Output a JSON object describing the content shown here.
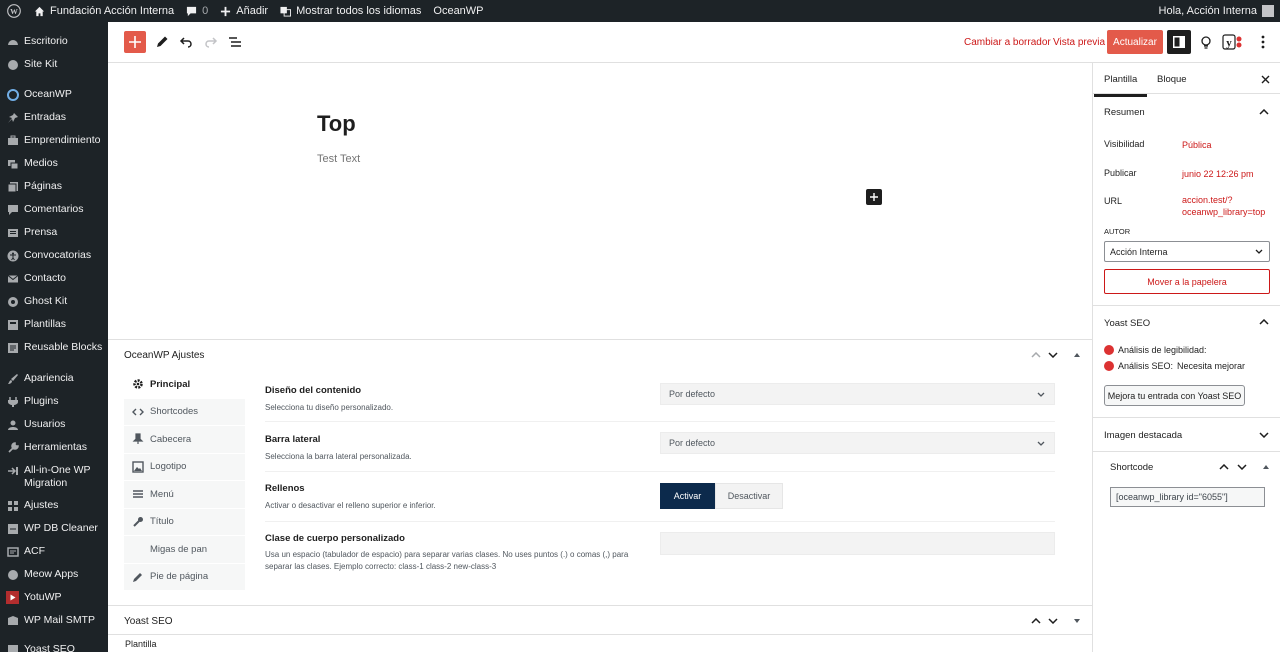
{
  "adminbar": {
    "site_name": "Fundación Acción Interna",
    "comments_count": "0",
    "add_new": "Añadir",
    "languages": "Mostrar todos los idiomas",
    "oceanwp": "OceanWP",
    "greeting": "Hola, Acción Interna"
  },
  "sidebar": {
    "items": [
      {
        "label": "Escritorio",
        "icon": "dashboard-icon"
      },
      {
        "label": "Site Kit",
        "icon": "sitekit-icon"
      },
      {
        "label": "OceanWP",
        "icon": "oceanwp-icon"
      },
      {
        "label": "Entradas",
        "icon": "pin-icon"
      },
      {
        "label": "Emprendimiento",
        "icon": "briefcase-icon"
      },
      {
        "label": "Medios",
        "icon": "media-icon"
      },
      {
        "label": "Páginas",
        "icon": "pages-icon"
      },
      {
        "label": "Comentarios",
        "icon": "comment-icon"
      },
      {
        "label": "Prensa",
        "icon": "press-icon"
      },
      {
        "label": "Convocatorias",
        "icon": "accessibility-icon"
      },
      {
        "label": "Contacto",
        "icon": "mail-icon"
      },
      {
        "label": "Ghost Kit",
        "icon": "ghostkit-icon"
      },
      {
        "label": "Plantillas",
        "icon": "templates-icon"
      },
      {
        "label": "Reusable Blocks",
        "icon": "blocks-icon"
      },
      {
        "label": "Apariencia",
        "icon": "brush-icon"
      },
      {
        "label": "Plugins",
        "icon": "plugin-icon"
      },
      {
        "label": "Usuarios",
        "icon": "users-icon"
      },
      {
        "label": "Herramientas",
        "icon": "tools-icon"
      },
      {
        "label": "All-in-One WP Migration",
        "icon": "migration-icon"
      },
      {
        "label": "Ajustes",
        "icon": "settings-icon"
      },
      {
        "label": "WP DB Cleaner",
        "icon": "db-icon"
      },
      {
        "label": "ACF",
        "icon": "acf-icon"
      },
      {
        "label": "Meow Apps",
        "icon": "meow-icon"
      },
      {
        "label": "YotuWP",
        "icon": "youtube-icon"
      },
      {
        "label": "WP Mail SMTP",
        "icon": "mail-smtp-icon"
      },
      {
        "label": "Yoast SEO",
        "icon": "yoast-icon"
      }
    ]
  },
  "toolbar": {
    "switch_draft": "Cambiar a borrador",
    "preview": "Vista previa",
    "update": "Actualizar"
  },
  "editor": {
    "title": "Top",
    "text": "Test Text"
  },
  "oceanwp_box": {
    "title": "OceanWP Ajustes",
    "nav": [
      {
        "label": "Principal",
        "icon": "gear-icon",
        "active": true
      },
      {
        "label": "Shortcodes",
        "icon": "code-icon"
      },
      {
        "label": "Cabecera",
        "icon": "pin-icon"
      },
      {
        "label": "Logotipo",
        "icon": "image-icon"
      },
      {
        "label": "Menú",
        "icon": "menu-icon"
      },
      {
        "label": "Título",
        "icon": "wrench-icon"
      },
      {
        "label": "Migas de pan",
        "icon": "breadcrumb-icon"
      },
      {
        "label": "Pie de página",
        "icon": "edit-icon"
      }
    ],
    "settings": {
      "layout": {
        "label": "Diseño del contenido",
        "desc": "Selecciona tu diseño personalizado.",
        "value": "Por defecto"
      },
      "sidebar": {
        "label": "Barra lateral",
        "desc": "Selecciona la barra lateral personalizada.",
        "value": "Por defecto"
      },
      "paddings": {
        "label": "Rellenos",
        "desc": "Activar o desactivar el relleno superior e inferior.",
        "on": "Activar",
        "off": "Desactivar"
      },
      "body_class": {
        "label": "Clase de cuerpo personalizado",
        "desc": "Usa un espacio (tabulador de espacio) para separar varias clases. No uses puntos (.) o comas (,) para separar las clases. Ejemplo correcto: class-1 class-2 new-class-3"
      }
    }
  },
  "yoast_box": {
    "title": "Yoast SEO"
  },
  "footer": {
    "breadcrumb": "Plantilla"
  },
  "settings_panel": {
    "tab_template": "Plantilla",
    "tab_block": "Bloque",
    "summary_title": "Resumen",
    "visibility_label": "Visibilidad",
    "visibility_value": "Pública",
    "publish_label": "Publicar",
    "publish_value": "junio 22 12:26 pm",
    "url_label": "URL",
    "url_line1": "accion.test/?",
    "url_line2": "oceanwp_library=top",
    "author_label": "AUTOR",
    "author_value": "Acción Interna",
    "trash": "Mover a la papelera",
    "yoast_title": "Yoast SEO",
    "readability_label": "Análisis de legibilidad:",
    "seo_label": "Análisis SEO:",
    "seo_value": "Necesita mejorar",
    "improve_button": "Mejora tu entrada con Yoast SEO",
    "featured_image": "Imagen destacada",
    "shortcode_title": "Shortcode",
    "shortcode_value": "[oceanwp_library id=\"6055\"]"
  },
  "colors": {
    "accent": "#e35a4a",
    "admin_dark": "#1d2327",
    "link_red": "#cc1818",
    "navy": "#0c2a4c"
  }
}
